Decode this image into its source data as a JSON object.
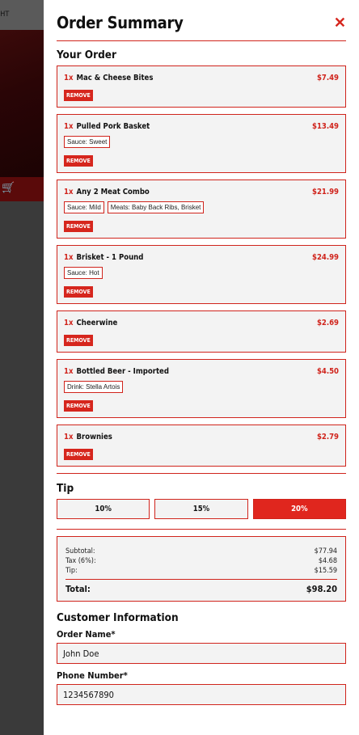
{
  "background": {
    "nav_text": "GHT"
  },
  "panel": {
    "title": "Order Summary",
    "your_order_heading": "Your Order",
    "items": [
      {
        "qty": "1x",
        "name": "Mac & Cheese Bites",
        "price": "$7.49",
        "mods": [],
        "remove_label": "REMOVE"
      },
      {
        "qty": "1x",
        "name": "Pulled Pork Basket",
        "price": "$13.49",
        "mods": [
          "Sauce: Sweet"
        ],
        "remove_label": "REMOVE"
      },
      {
        "qty": "1x",
        "name": "Any 2 Meat Combo",
        "price": "$21.99",
        "mods": [
          "Sauce: Mild",
          "Meats: Baby Back Ribs, Brisket"
        ],
        "remove_label": "REMOVE"
      },
      {
        "qty": "1x",
        "name": "Brisket - 1 Pound",
        "price": "$24.99",
        "mods": [
          "Sauce: Hot"
        ],
        "remove_label": "REMOVE"
      },
      {
        "qty": "1x",
        "name": "Cheerwine",
        "price": "$2.69",
        "mods": [],
        "remove_label": "REMOVE"
      },
      {
        "qty": "1x",
        "name": "Bottled Beer - Imported",
        "price": "$4.50",
        "mods": [
          "Drink: Stella Artois"
        ],
        "remove_label": "REMOVE"
      },
      {
        "qty": "1x",
        "name": "Brownies",
        "price": "$2.79",
        "mods": [],
        "remove_label": "REMOVE"
      }
    ],
    "tip": {
      "heading": "Tip",
      "options": [
        "10%",
        "15%",
        "20%"
      ],
      "selected": "20%"
    },
    "summary": {
      "subtotal_label": "Subtotal:",
      "subtotal": "$77.94",
      "tax_label": "Tax (6%):",
      "tax": "$4.68",
      "tip_label": "Tip:",
      "tip": "$15.59",
      "total_label": "Total:",
      "total": "$98.20"
    },
    "customer": {
      "heading": "Customer Information",
      "order_name_label": "Order Name*",
      "order_name_value": "John Doe",
      "phone_label": "Phone Number*",
      "phone_value": "1234567890"
    }
  },
  "colors": {
    "accent": "#d6261d",
    "item_bg": "#f3f3f3"
  }
}
